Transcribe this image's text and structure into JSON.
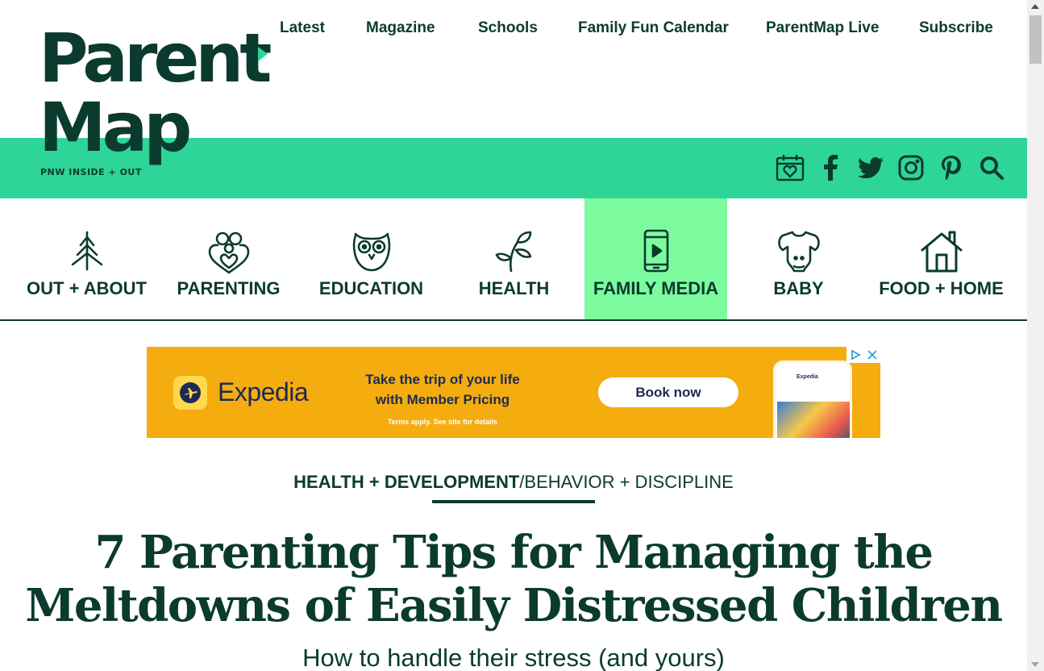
{
  "top_nav": [
    "Latest",
    "Magazine",
    "Schools",
    "Family Fun Calendar",
    "ParentMap Live",
    "Subscribe"
  ],
  "logo": {
    "line1": "Parent",
    "line2": "Map",
    "tagline": "PNW INSIDE + OUT"
  },
  "social_icons": [
    "calendar-heart-icon",
    "facebook-icon",
    "twitter-icon",
    "instagram-icon",
    "pinterest-icon",
    "search-icon"
  ],
  "categories": [
    {
      "label": "OUT + ABOUT",
      "icon": "tree-icon",
      "active": false
    },
    {
      "label": "PARENTING",
      "icon": "family-heart-icon",
      "active": false
    },
    {
      "label": "EDUCATION",
      "icon": "owl-icon",
      "active": false
    },
    {
      "label": "HEALTH",
      "icon": "sprout-icon",
      "active": false
    },
    {
      "label": "FAMILY MEDIA",
      "icon": "phone-play-icon",
      "active": true
    },
    {
      "label": "BABY",
      "icon": "onesie-icon",
      "active": false
    },
    {
      "label": "FOOD + HOME",
      "icon": "house-icon",
      "active": false
    }
  ],
  "ad": {
    "brand": "Expedia",
    "headline": "Take the trip of your life with Member Pricing",
    "terms": "Terms apply. See site for details",
    "cta": "Book now",
    "phone_label": "Expedia"
  },
  "article": {
    "kicker_primary": "HEALTH + DEVELOPMENT",
    "kicker_separator": "/",
    "kicker_secondary": "BEHAVIOR + DISCIPLINE",
    "title": "7 Parenting Tips for Managing the Meltdowns of Easily Distressed Children",
    "subtitle": "How to handle their stress (and yours)"
  },
  "colors": {
    "brand_dark": "#0b3b2e",
    "brand_green": "#2ed598",
    "active_tab": "#7cfb9e",
    "ad_background": "#f4ac0f"
  }
}
